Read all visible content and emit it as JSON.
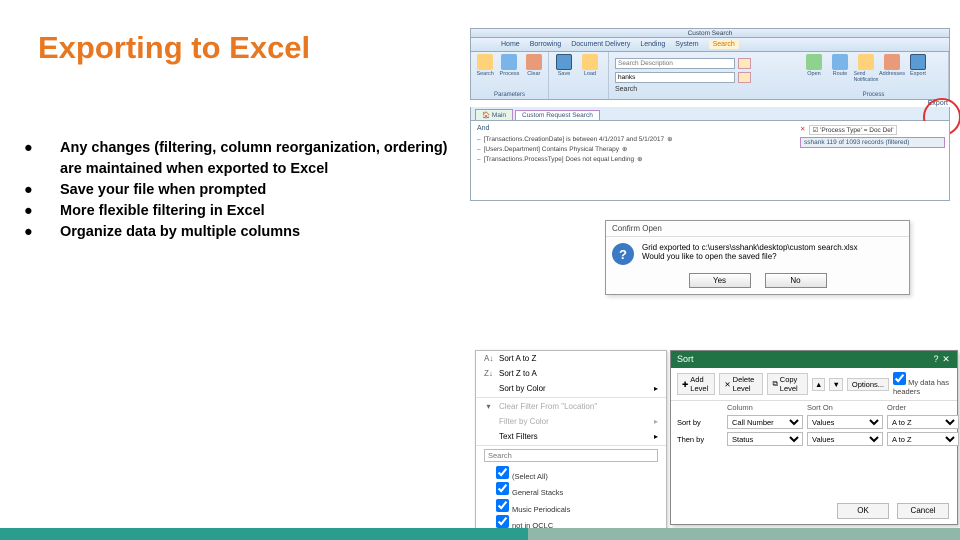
{
  "slide": {
    "title": "Exporting to Excel",
    "bullets": [
      "Any changes (filtering, column reorganization, ordering) are maintained when exported to Excel",
      "Save your file when prompted",
      "More flexible filtering in Excel",
      "Organize data by multiple columns"
    ]
  },
  "app": {
    "window_title": "Custom Search",
    "menu": [
      "Home",
      "Borrowing",
      "Document Delivery",
      "Lending",
      "System",
      "Search"
    ],
    "ribbon": {
      "groups": [
        {
          "label": "Parameters",
          "icons": [
            "Search",
            "Process",
            "Clear"
          ]
        },
        {
          "label": "Search",
          "icons": [
            "Save",
            "Load"
          ],
          "placeholder": "hanks"
        },
        {
          "label": "Process",
          "icons": [
            "Open",
            "Route",
            "Send Notification",
            "Addresses",
            "Export"
          ]
        }
      ],
      "export_label_below": "Export"
    },
    "tabs": {
      "main": "Main",
      "active": "Custom Request Search"
    },
    "criteria_label": "And",
    "criteria": [
      "[Transactions.CreationDate] is between 4/1/2017 and 5/1/2017",
      "[Users.Department] Contains Physical Therapy",
      "[Transactions.ProcessType] Does not equal Lending"
    ],
    "process_chip_label": "'Process Type' = Doc Del'",
    "filtered_status": "sshank   119 of 1093 records (filtered)"
  },
  "confirm": {
    "title": "Confirm Open",
    "line1": "Grid exported to c:\\users\\sshank\\desktop\\custom search.xlsx",
    "line2": "Would you like to open the saved file?",
    "yes": "Yes",
    "no": "No"
  },
  "filtermenu": {
    "sort_az": "Sort A to Z",
    "sort_za": "Sort Z to A",
    "sort_color": "Sort by Color",
    "clear": "Clear Filter From \"Location\"",
    "filter_color": "Filter by Color",
    "text_filters": "Text Filters",
    "search_placeholder": "Search",
    "checks": [
      "(Select All)",
      "General Stacks",
      "Music Periodicals",
      "not in OCLC"
    ]
  },
  "sortdlg": {
    "title": "Sort",
    "btn_add": "Add Level",
    "btn_delete": "Delete Level",
    "btn_copy": "Copy Level",
    "btn_options": "Options...",
    "headers_check": "My data has headers",
    "col_header": "Column",
    "sorton_header": "Sort On",
    "order_header": "Order",
    "rows": [
      {
        "label": "Sort by",
        "column": "Call Number",
        "sort_on": "Values",
        "order": "A to Z"
      },
      {
        "label": "Then by",
        "column": "Status",
        "sort_on": "Values",
        "order": "A to Z"
      }
    ],
    "ok": "OK",
    "cancel": "Cancel"
  }
}
